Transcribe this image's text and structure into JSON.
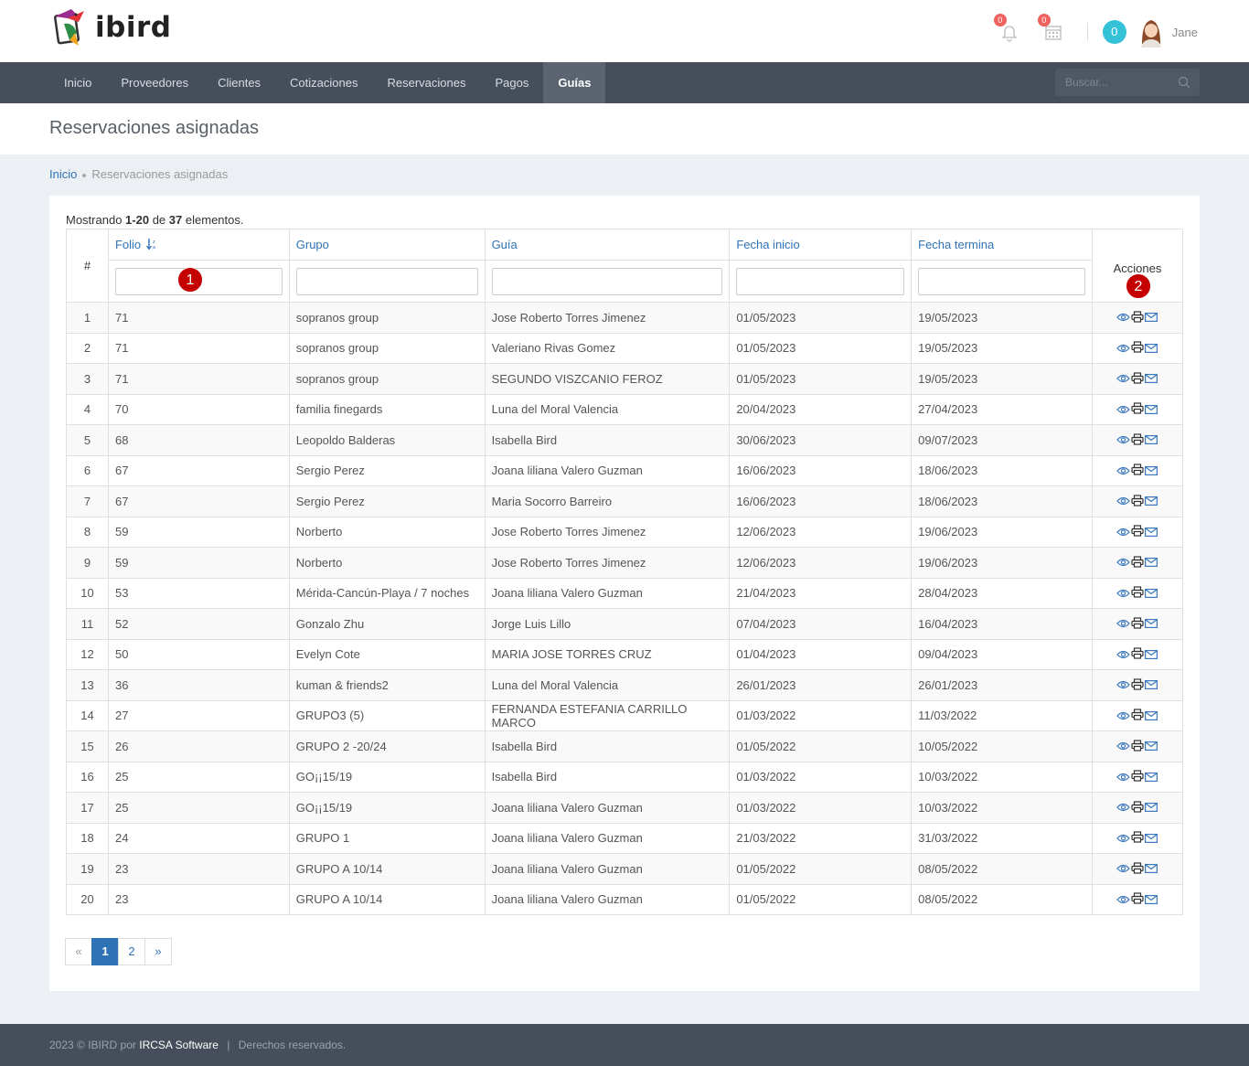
{
  "app": {
    "logo_text": "ibird",
    "notifications_count": "0",
    "calendar_count": "0",
    "messages_count": "0",
    "user_name": "Jane"
  },
  "nav": {
    "items": [
      {
        "label": "Inicio"
      },
      {
        "label": "Proveedores"
      },
      {
        "label": "Clientes"
      },
      {
        "label": "Cotizaciones"
      },
      {
        "label": "Reservaciones"
      },
      {
        "label": "Pagos"
      },
      {
        "label": "Guías"
      }
    ],
    "active": "Guías",
    "search_placeholder": "Buscar..."
  },
  "page": {
    "title": "Reservaciones asignadas",
    "breadcrumb": {
      "home": "Inicio",
      "current": "Reservaciones asignadas"
    }
  },
  "summary": {
    "prefix": "Mostrando",
    "range": "1-20",
    "of": "de",
    "total": "37",
    "suffix": "elementos."
  },
  "table": {
    "columns": {
      "index": "#",
      "folio": "Folio",
      "grupo": "Grupo",
      "guia": "Guía",
      "fecha_inicio": "Fecha inicio",
      "fecha_termina": "Fecha termina",
      "acciones": "Acciones"
    },
    "rows": [
      {
        "n": "1",
        "folio": "71",
        "grupo": "sopranos group",
        "guia": "Jose Roberto Torres Jimenez",
        "inicio": "01/05/2023",
        "termina": "19/05/2023"
      },
      {
        "n": "2",
        "folio": "71",
        "grupo": "sopranos group",
        "guia": "Valeriano Rivas Gomez",
        "inicio": "01/05/2023",
        "termina": "19/05/2023"
      },
      {
        "n": "3",
        "folio": "71",
        "grupo": "sopranos group",
        "guia": "SEGUNDO VISZCANIO FEROZ",
        "inicio": "01/05/2023",
        "termina": "19/05/2023"
      },
      {
        "n": "4",
        "folio": "70",
        "grupo": "familia finegards",
        "guia": "Luna del Moral Valencia",
        "inicio": "20/04/2023",
        "termina": "27/04/2023"
      },
      {
        "n": "5",
        "folio": "68",
        "grupo": "Leopoldo Balderas",
        "guia": "Isabella Bird",
        "inicio": "30/06/2023",
        "termina": "09/07/2023"
      },
      {
        "n": "6",
        "folio": "67",
        "grupo": "Sergio Perez",
        "guia": "Joana liliana Valero Guzman",
        "inicio": "16/06/2023",
        "termina": "18/06/2023"
      },
      {
        "n": "7",
        "folio": "67",
        "grupo": "Sergio Perez",
        "guia": "Maria Socorro Barreiro",
        "inicio": "16/06/2023",
        "termina": "18/06/2023"
      },
      {
        "n": "8",
        "folio": "59",
        "grupo": "Norberto",
        "guia": "Jose Roberto Torres Jimenez",
        "inicio": "12/06/2023",
        "termina": "19/06/2023"
      },
      {
        "n": "9",
        "folio": "59",
        "grupo": "Norberto",
        "guia": "Jose Roberto Torres Jimenez",
        "inicio": "12/06/2023",
        "termina": "19/06/2023"
      },
      {
        "n": "10",
        "folio": "53",
        "grupo": "Mérida-Cancún-Playa / 7 noches",
        "guia": "Joana liliana Valero Guzman",
        "inicio": "21/04/2023",
        "termina": "28/04/2023"
      },
      {
        "n": "11",
        "folio": "52",
        "grupo": "Gonzalo Zhu",
        "guia": "Jorge Luis Lillo",
        "inicio": "07/04/2023",
        "termina": "16/04/2023"
      },
      {
        "n": "12",
        "folio": "50",
        "grupo": "Evelyn Cote",
        "guia": "MARIA JOSE TORRES CRUZ",
        "inicio": "01/04/2023",
        "termina": "09/04/2023"
      },
      {
        "n": "13",
        "folio": "36",
        "grupo": "kuman & friends2",
        "guia": "Luna del Moral Valencia",
        "inicio": "26/01/2023",
        "termina": "26/01/2023"
      },
      {
        "n": "14",
        "folio": "27",
        "grupo": "GRUPO3 (5)",
        "guia": "FERNANDA ESTEFANIA CARRILLO MARCO",
        "inicio": "01/03/2022",
        "termina": "11/03/2022"
      },
      {
        "n": "15",
        "folio": "26",
        "grupo": "GRUPO 2 -20/24",
        "guia": "Isabella Bird",
        "inicio": "01/05/2022",
        "termina": "10/05/2022"
      },
      {
        "n": "16",
        "folio": "25",
        "grupo": "GO¡¡15/19",
        "guia": "Isabella Bird",
        "inicio": "01/03/2022",
        "termina": "10/03/2022"
      },
      {
        "n": "17",
        "folio": "25",
        "grupo": "GO¡¡15/19",
        "guia": "Joana liliana Valero Guzman",
        "inicio": "01/03/2022",
        "termina": "10/03/2022"
      },
      {
        "n": "18",
        "folio": "24",
        "grupo": "GRUPO 1",
        "guia": "Joana liliana Valero Guzman",
        "inicio": "21/03/2022",
        "termina": "31/03/2022"
      },
      {
        "n": "19",
        "folio": "23",
        "grupo": "GRUPO A 10/14",
        "guia": "Joana liliana Valero Guzman",
        "inicio": "01/05/2022",
        "termina": "08/05/2022"
      },
      {
        "n": "20",
        "folio": "23",
        "grupo": "GRUPO A 10/14",
        "guia": "Joana liliana Valero Guzman",
        "inicio": "01/05/2022",
        "termina": "08/05/2022"
      }
    ]
  },
  "markers": {
    "one": "1",
    "two": "2"
  },
  "pagination": {
    "prev": "«",
    "pages": [
      "1",
      "2"
    ],
    "next": "»",
    "current": "1"
  },
  "footer": {
    "year_text": "2023 © IBIRD por",
    "brand": "IRCSA Software",
    "separator": "|",
    "rights": "Derechos reservados."
  },
  "colors": {
    "nav_bg": "#454e5a",
    "accent": "#2f73b7",
    "marker": "#c40000",
    "badge": "#f0625d",
    "teal": "#35c2d7"
  },
  "icons": [
    "bell-icon",
    "calendar-icon",
    "search-icon",
    "sort-icon",
    "eye-icon",
    "print-icon",
    "envelope-icon"
  ]
}
